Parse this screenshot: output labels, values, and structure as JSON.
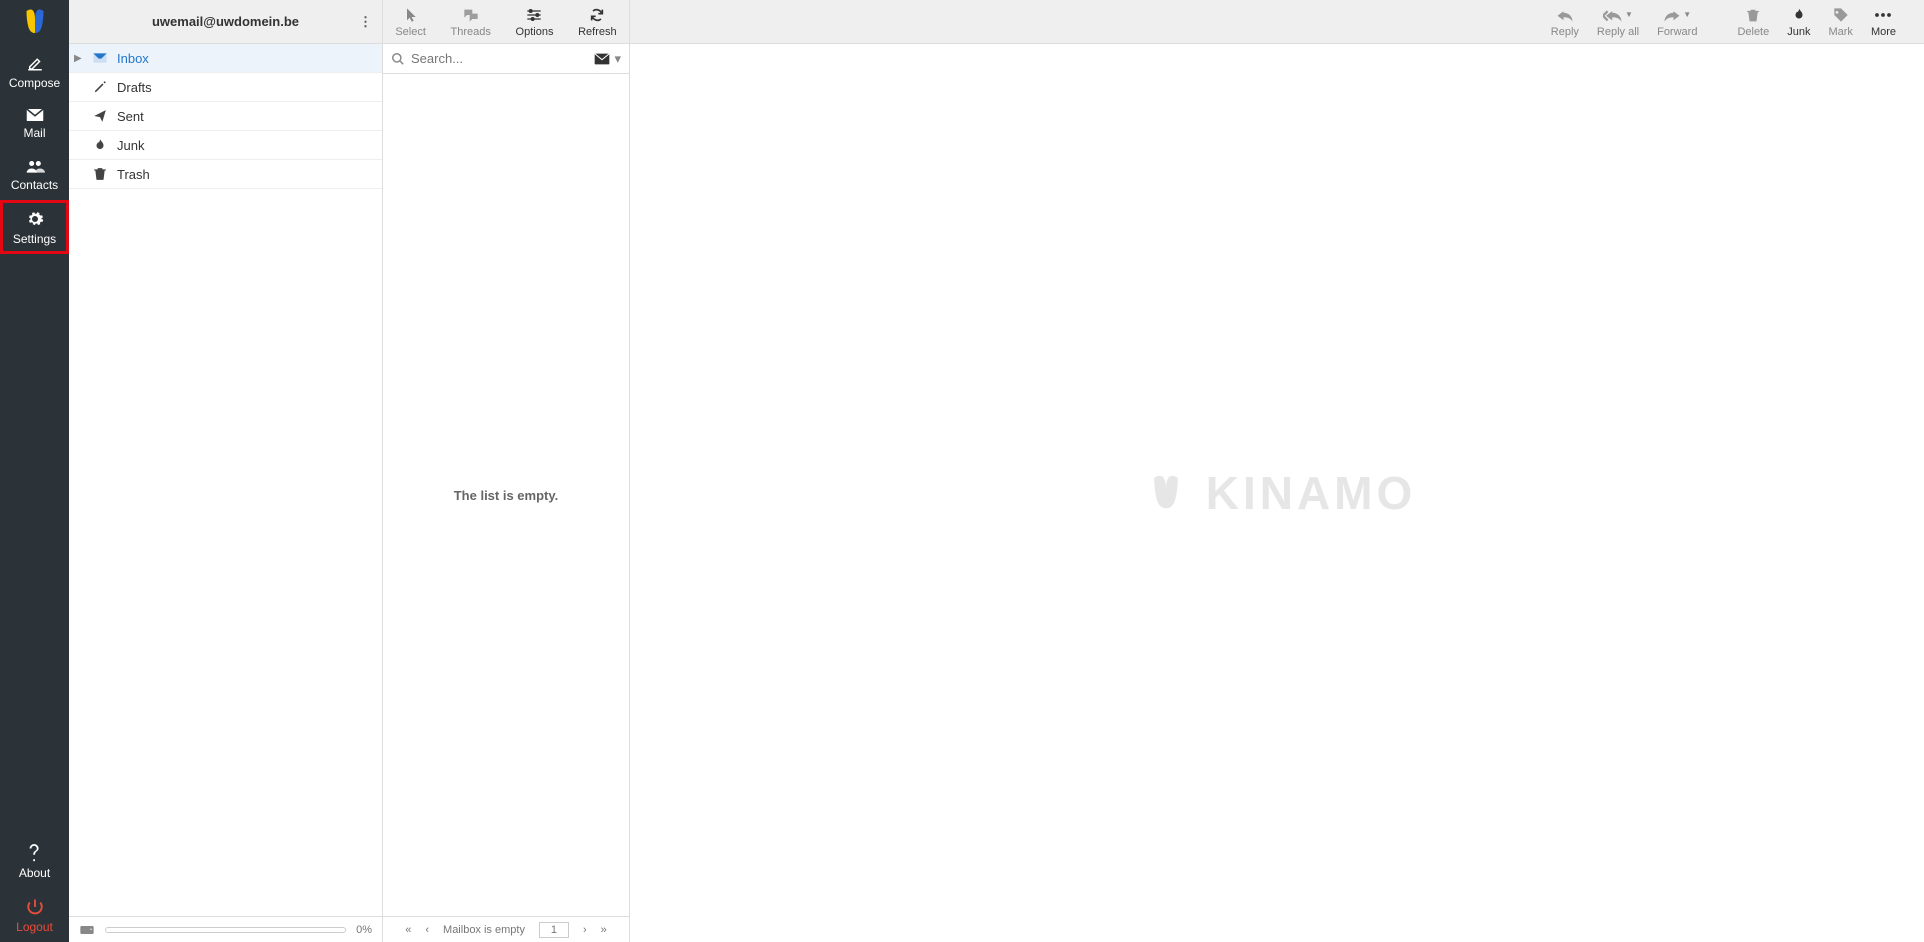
{
  "account_email": "uwemail@uwdomein.be",
  "sidebar": {
    "compose": "Compose",
    "mail": "Mail",
    "contacts": "Contacts",
    "settings": "Settings",
    "about": "About",
    "logout": "Logout"
  },
  "folders": [
    {
      "label": "Inbox"
    },
    {
      "label": "Drafts"
    },
    {
      "label": "Sent"
    },
    {
      "label": "Junk"
    },
    {
      "label": "Trash"
    }
  ],
  "quota_pct": "0%",
  "list_toolbar": {
    "select": "Select",
    "threads": "Threads",
    "options": "Options",
    "refresh": "Refresh"
  },
  "search_placeholder": "Search...",
  "list_empty": "The list is empty.",
  "list_footer": {
    "status": "Mailbox is empty",
    "page": "1"
  },
  "msg_toolbar": {
    "reply": "Reply",
    "replyall": "Reply all",
    "forward": "Forward",
    "delete": "Delete",
    "junk": "Junk",
    "mark": "Mark",
    "more": "More"
  },
  "brand": "KINAMO"
}
